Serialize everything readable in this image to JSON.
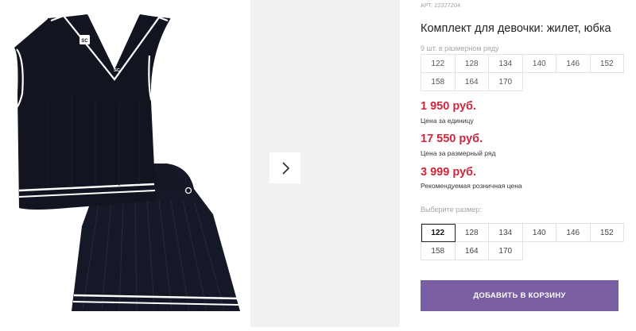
{
  "product": {
    "sku": "АРТ. 22327204",
    "title": "Комплект для девочки: жилет, юбка",
    "sizes_count_note": "9 шт. в размерном ряду",
    "size_range": [
      "122",
      "128",
      "134",
      "140",
      "146",
      "152",
      "158",
      "164",
      "170"
    ],
    "prices": [
      {
        "value": "1 950 руб.",
        "note": "Цена за единицу"
      },
      {
        "value": "17 550 руб.",
        "note": "Цена за размерный ряд"
      },
      {
        "value": "3 999 руб.",
        "note": "Рекомендуемая розничная цена"
      }
    ],
    "choose_size_label": "Выберите размер:",
    "selectable_sizes": [
      "122",
      "128",
      "134",
      "140",
      "146",
      "152",
      "158",
      "164",
      "170"
    ],
    "selected_size": "122",
    "add_to_cart_label": "ДОБАВИТЬ В КОРЗИНУ",
    "vest_logo": "SC"
  },
  "colors": {
    "price": "#d0253a",
    "button": "#7a5fa4",
    "garment": "#111420"
  },
  "icons": {
    "next": "chevron-right-icon"
  }
}
